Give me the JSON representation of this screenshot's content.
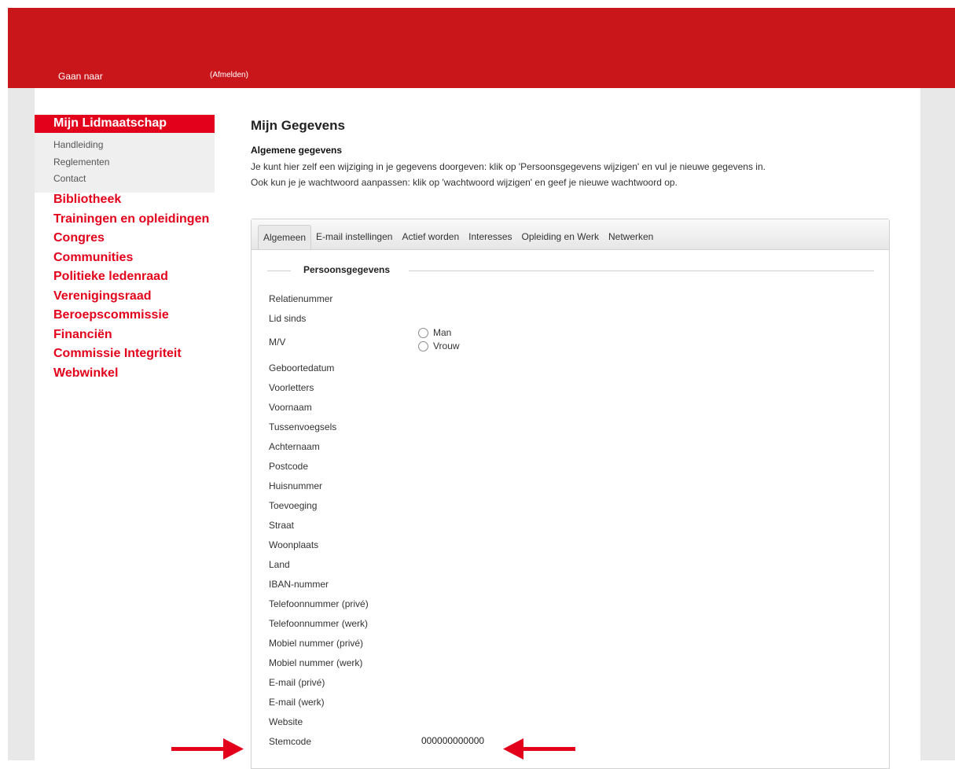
{
  "header": {
    "goto_label": "Gaan naar",
    "logout_label": "(Afmelden)"
  },
  "sidebar": {
    "title": "Mijn Lidmaatschap",
    "sub_items": [
      "Handleiding",
      "Reglementen",
      "Contact"
    ],
    "main_items": [
      "Bibliotheek",
      "Trainingen en opleidingen",
      "Congres",
      "Communities",
      "Politieke ledenraad",
      "Verenigingsraad",
      "Beroepscommissie",
      "Financiën",
      "Commissie Integriteit",
      "Webwinkel"
    ]
  },
  "main": {
    "title": "Mijn Gegevens",
    "section_title": "Algemene gegevens",
    "intro_line1": "Je kunt hier zelf een wijziging in je gegevens doorgeven: klik op 'Persoonsgegevens wijzigen' en vul je nieuwe gegevens in.",
    "intro_line2": "Ook kun je je wachtwoord aanpassen: klik op 'wachtwoord wijzigen' en geef je nieuwe wachtwoord op.",
    "tabs": [
      "Algemeen",
      "E-mail instellingen",
      "Actief worden",
      "Interesses",
      "Opleiding en Werk",
      "Netwerken"
    ],
    "legend": "Persoonsgegevens",
    "fields": [
      "Relatienummer",
      "Lid sinds",
      "M/V",
      "Geboortedatum",
      "Voorletters",
      "Voornaam",
      "Tussenvoegsels",
      "Achternaam",
      "Postcode",
      "Huisnummer",
      "Toevoeging",
      "Straat",
      "Woonplaats",
      "Land",
      "IBAN-nummer",
      "Telefoonnummer (privé)",
      "Telefoonnummer (werk)",
      "Mobiel nummer (privé)",
      "Mobiel nummer (werk)",
      "E-mail (privé)",
      "E-mail (werk)",
      "Website",
      "Stemcode"
    ],
    "gender_options": [
      "Man",
      "Vrouw"
    ],
    "stemcode_value": "000000000000"
  },
  "colors": {
    "brand_red": "#c8161b",
    "accent_red": "#e3001b"
  }
}
